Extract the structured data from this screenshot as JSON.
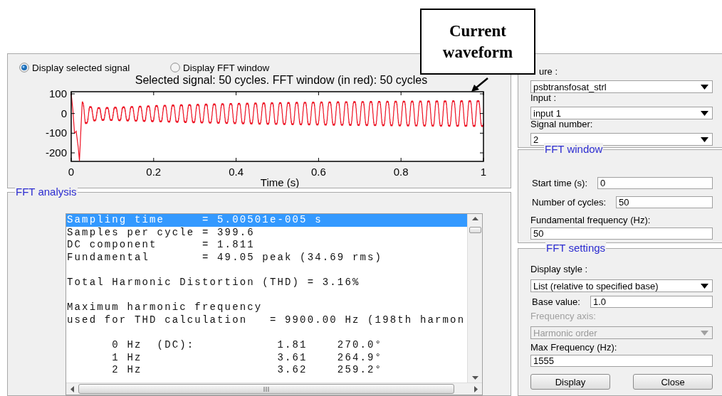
{
  "signal_panel": {
    "radios": [
      {
        "label": "Display selected signal",
        "selected": true
      },
      {
        "label": "Display FFT window",
        "selected": false
      }
    ],
    "plot": {
      "title": "Selected signal: 50 cycles. FFT window (in red): 50 cycles",
      "yticks": [
        "100",
        "0",
        "-100",
        "-200"
      ],
      "xticks": [
        "0",
        "0.2",
        "0.4",
        "0.6",
        "0.8",
        "1"
      ],
      "xlabel": "Time (s)"
    }
  },
  "fft_analysis": {
    "title": "FFT analysis",
    "lines": [
      {
        "kind": "text",
        "text": "Sampling time     = 5.00501e-005 s",
        "selected": true
      },
      {
        "kind": "text",
        "text": "Samples per cycle = 399.6",
        "selected": false
      },
      {
        "kind": "text",
        "text": "DC component      = 1.811",
        "selected": false
      },
      {
        "kind": "text",
        "text": "Fundamental       = 49.05 peak (34.69 rms)",
        "selected": false
      },
      {
        "kind": "blank"
      },
      {
        "kind": "text",
        "text": "Total Harmonic Distortion (THD) = 3.16%",
        "selected": false
      },
      {
        "kind": "blank"
      },
      {
        "kind": "text",
        "text": "Maximum harmonic frequency",
        "selected": false
      },
      {
        "kind": "text",
        "text": "used for THD calculation   = 9900.00 Hz (198th harmon",
        "selected": false
      },
      {
        "kind": "blank"
      },
      {
        "kind": "text",
        "text": "      0 Hz  (DC):           1.81    270.0°",
        "selected": false
      },
      {
        "kind": "text",
        "text": "      1 Hz                  3.61    264.9°",
        "selected": false
      },
      {
        "kind": "text",
        "text": "      2 Hz                  3.62    259.2°",
        "selected": false
      }
    ]
  },
  "selection_panel": {
    "items": [
      {
        "kind": "combo",
        "label": "ure :",
        "value": "psbtransfosat_strl"
      },
      {
        "kind": "combo",
        "label": "Input :",
        "value": "input 1"
      },
      {
        "kind": "combo",
        "label": "Signal number:",
        "value": "2"
      }
    ]
  },
  "fft_window": {
    "title": "FFT window",
    "items": [
      {
        "kind": "inline",
        "label": "Start time (s):",
        "value": "0"
      },
      {
        "kind": "inline",
        "label": "Number of cycles:",
        "value": "50"
      },
      {
        "kind": "stacked",
        "label": "Fundamental frequency (Hz):",
        "value": "50"
      }
    ]
  },
  "fft_settings": {
    "title": "FFT settings",
    "items": [
      {
        "kind": "combo",
        "label": "Display style :",
        "value": "List (relative to specified base)",
        "disabled": false
      },
      {
        "kind": "inline",
        "label": "Base value:",
        "value": "1.0"
      },
      {
        "kind": "combo",
        "label": "Frequency axis:",
        "value": "Harmonic order",
        "disabled": true
      },
      {
        "kind": "stacked",
        "label": "Max Frequency (Hz):",
        "value": "1555"
      }
    ],
    "buttons": [
      "Display",
      "Close"
    ]
  },
  "callout": {
    "text": "Current waveform"
  }
}
